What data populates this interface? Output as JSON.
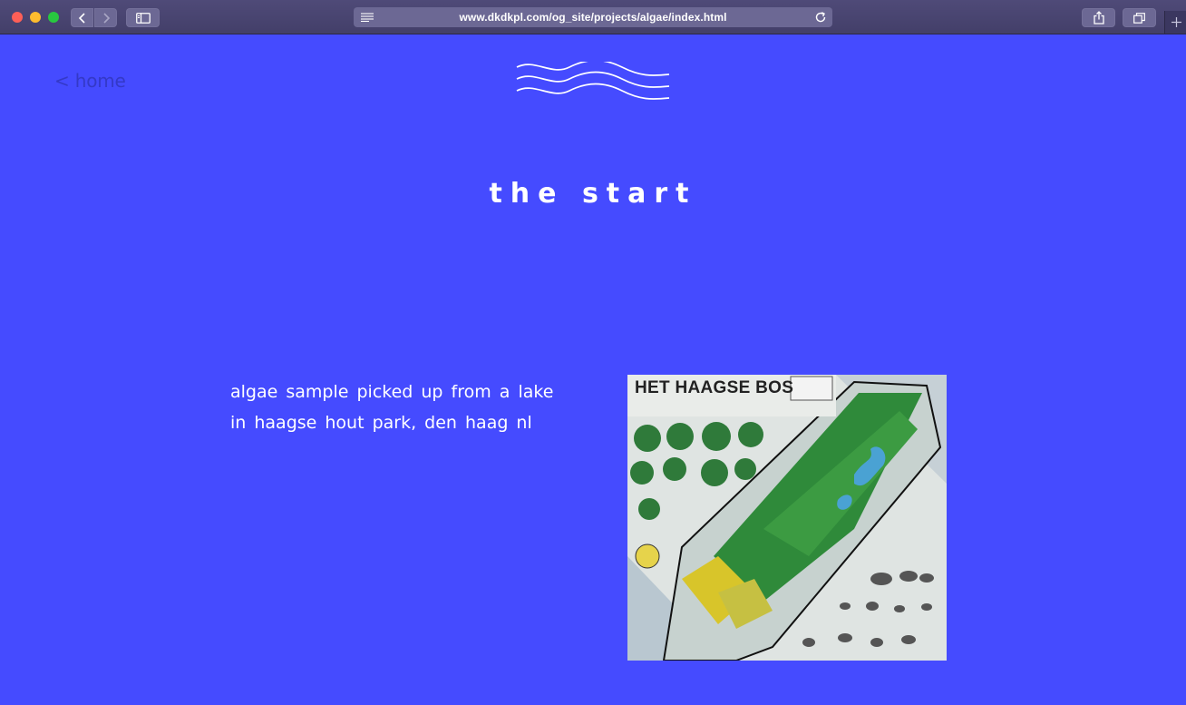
{
  "browser": {
    "url": "www.dkdkpl.com/og_site/projects/algae/index.html",
    "icons": [
      "back-icon",
      "forward-icon",
      "sidebar-icon",
      "reader-icon",
      "reload-icon",
      "share-icon",
      "tabs-icon",
      "new-tab-icon"
    ]
  },
  "page": {
    "home_link": "< home",
    "title": "the start",
    "description": "algae sample picked up from a lake in haagse hout park, den haag nl",
    "image": {
      "title": "HET HAAGSE BOS",
      "logo_icon": "waves-icon"
    }
  },
  "colors": {
    "background": "#454BFF",
    "link": "#3439c7",
    "text": "#ffffff"
  }
}
